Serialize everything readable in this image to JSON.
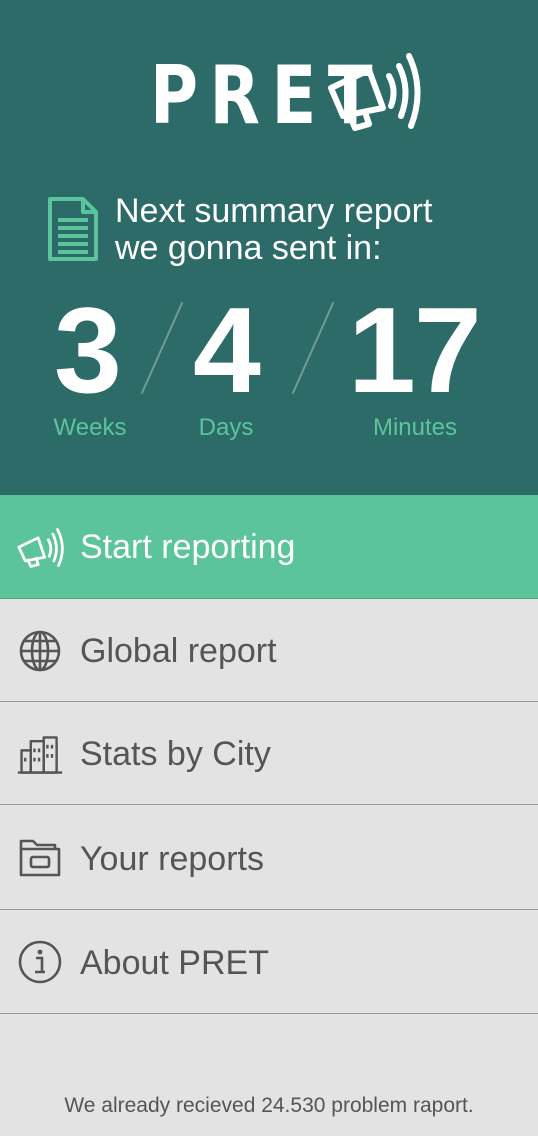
{
  "header": {
    "logo_text": "PRET",
    "logo_icon": "megaphone-icon",
    "doc_icon": "document-icon",
    "message_line1": "Next summary report",
    "message_line2": "we gonna sent in:"
  },
  "countdown": [
    {
      "value": "3",
      "unit": "Weeks"
    },
    {
      "value": "4",
      "unit": "Days"
    },
    {
      "value": "17",
      "unit": "Minutes"
    }
  ],
  "menu": [
    {
      "label": "Start reporting",
      "icon": "megaphone-icon",
      "active": true
    },
    {
      "label": "Global report",
      "icon": "globe-icon",
      "active": false
    },
    {
      "label": "Stats by City",
      "icon": "buildings-icon",
      "active": false
    },
    {
      "label": "Your reports",
      "icon": "folder-icon",
      "active": false
    },
    {
      "label": "About PRET",
      "icon": "info-icon",
      "active": false
    }
  ],
  "footer": {
    "note": "We already recieved 24.530 problem raport."
  },
  "colors": {
    "header_bg": "#2d6b68",
    "accent": "#5cc49c",
    "menu_bg": "#e3e3e3",
    "menu_text": "#555555"
  }
}
